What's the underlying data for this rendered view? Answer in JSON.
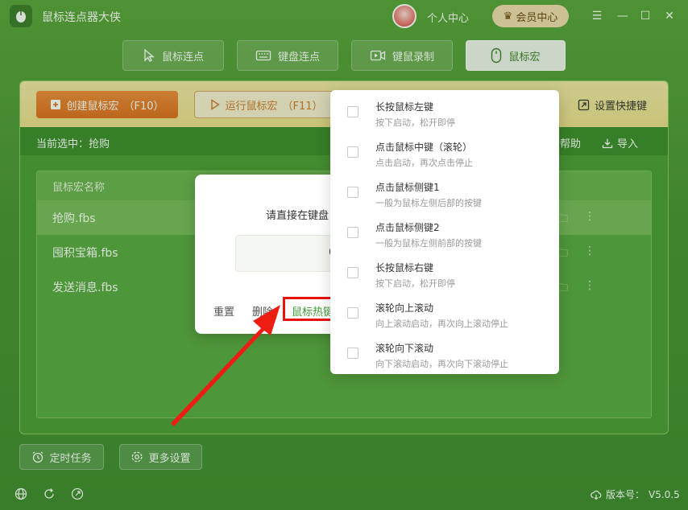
{
  "app": {
    "title": "鼠标连点器大侠"
  },
  "header": {
    "profile_label": "个人中心",
    "vip_label": "会员中心"
  },
  "modes": [
    {
      "label": "鼠标连点",
      "icon": "cursor-icon"
    },
    {
      "label": "键盘连点",
      "icon": "keyboard-icon"
    },
    {
      "label": "键鼠录制",
      "icon": "record-icon"
    },
    {
      "label": "鼠标宏",
      "icon": "mouse-icon",
      "active": true
    }
  ],
  "toolbar": {
    "create_label": "创建鼠标宏",
    "create_key": "（F10）",
    "run_label": "运行鼠标宏",
    "run_key": "（F11）",
    "hotkey_label": "设置快捷键"
  },
  "status": {
    "current_label": "当前选中：",
    "current_value": "抢购",
    "help_label": "帮助",
    "import_label": "导入"
  },
  "list": {
    "header": "鼠标宏名称",
    "rows": [
      {
        "name": "抢购.fbs",
        "selected": true
      },
      {
        "name": "囤积宝箱.fbs",
        "selected": false
      },
      {
        "name": "发送消息.fbs",
        "selected": false
      }
    ]
  },
  "dialog": {
    "prompt": "请直接在键盘",
    "key_value": "0",
    "reset_label": "重置",
    "delete_label": "删除",
    "mouse_hotkey_label": "鼠标热键"
  },
  "dropdown": {
    "items": [
      {
        "title": "长按鼠标左键",
        "desc": "按下启动，松开即停"
      },
      {
        "title": "点击鼠标中键（滚轮）",
        "desc": "点击启动，再次点击停止"
      },
      {
        "title": "点击鼠标侧键1",
        "desc": "一般为鼠标左侧后部的按键"
      },
      {
        "title": "点击鼠标侧键2",
        "desc": "一般为鼠标左侧前部的按键"
      },
      {
        "title": "长按鼠标右键",
        "desc": "按下启动，松开即停"
      },
      {
        "title": "滚轮向上滚动",
        "desc": "向上滚动启动，再次向上滚动停止"
      },
      {
        "title": "滚轮向下滚动",
        "desc": "向下滚动启动，再次向下滚动停止"
      }
    ]
  },
  "footer": {
    "timer_label": "定时任务",
    "settings_label": "更多设置",
    "version_label": "版本号：",
    "version_value": "V5.0.5"
  },
  "colors": {
    "primary_green": "#4a9334",
    "accent_orange": "#e06d1e",
    "highlight_red": "#e8120c",
    "active_text": "#3d9a34"
  }
}
